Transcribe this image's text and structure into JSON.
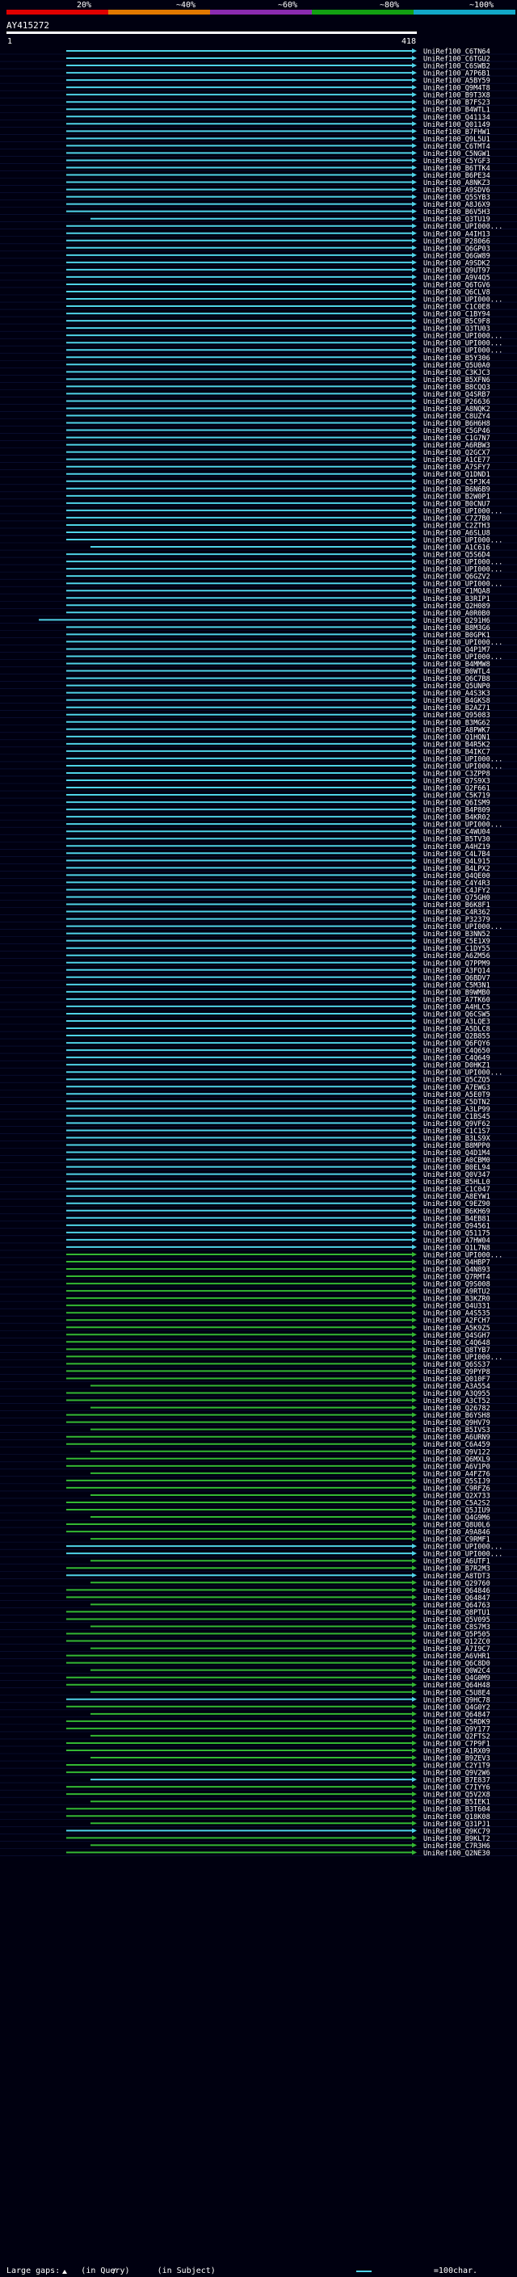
{
  "scale": {
    "labels": [
      "20%",
      "~40%",
      "~60%",
      "~80%",
      "~100%"
    ],
    "colors": [
      "#e00000",
      "#e07800",
      "#8a2bb0",
      "#12a012",
      "#12a8c8"
    ]
  },
  "query": {
    "id": "AY415272",
    "start": "1",
    "end": "418"
  },
  "colors": {
    "background": "#000010",
    "cyan": "#4fd3e8",
    "green": "#33b833",
    "query_bar": "#ffffff"
  },
  "hits": [
    {
      "id": "UniRef100_C6TN64",
      "c": "c"
    },
    {
      "id": "UniRef100_C6TGU2",
      "c": "c"
    },
    {
      "id": "UniRef100_C6SWB2",
      "c": "c"
    },
    {
      "id": "UniRef100_A7P6B1",
      "c": "c"
    },
    {
      "id": "UniRef100_A5BY59",
      "c": "c"
    },
    {
      "id": "UniRef100_Q9M4T8",
      "c": "c"
    },
    {
      "id": "UniRef100_B9T3X8",
      "c": "c"
    },
    {
      "id": "UniRef100_B7FS23",
      "c": "c"
    },
    {
      "id": "UniRef100_B4WTL1",
      "c": "c"
    },
    {
      "id": "UniRef100_Q41134",
      "c": "c"
    },
    {
      "id": "UniRef100_Q01149",
      "c": "c"
    },
    {
      "id": "UniRef100_B7FHW1",
      "c": "c"
    },
    {
      "id": "UniRef100_Q9L5U1",
      "c": "c"
    },
    {
      "id": "UniRef100_C6TMT4",
      "c": "c"
    },
    {
      "id": "UniRef100_C5NGW1",
      "c": "c"
    },
    {
      "id": "UniRef100_C5YGF3",
      "c": "c"
    },
    {
      "id": "UniRef100_B6TTK4",
      "c": "c"
    },
    {
      "id": "UniRef100_B6PE34",
      "c": "c"
    },
    {
      "id": "UniRef100_A8NKZ3",
      "c": "c"
    },
    {
      "id": "UniRef100_A9SDV6",
      "c": "c"
    },
    {
      "id": "UniRef100_Q5SYB3",
      "c": "c"
    },
    {
      "id": "UniRef100_A8J6X9",
      "c": "c"
    },
    {
      "id": "UniRef100_B6V5H3",
      "c": "c"
    },
    {
      "id": "UniRef100_Q3TU19",
      "c": "c"
    },
    {
      "id": "UniRef100_UPI000...",
      "c": "c"
    },
    {
      "id": "UniRef100_A4IH13",
      "c": "c"
    },
    {
      "id": "UniRef100_P28066",
      "c": "c"
    },
    {
      "id": "UniRef100_Q6GP03",
      "c": "c"
    },
    {
      "id": "UniRef100_Q6GW89",
      "c": "c"
    },
    {
      "id": "UniRef100_A9SDK2",
      "c": "c"
    },
    {
      "id": "UniRef100_Q9UT97",
      "c": "c"
    },
    {
      "id": "UniRef100_A9V4Q5",
      "c": "c"
    },
    {
      "id": "UniRef100_Q6TGV6",
      "c": "c"
    },
    {
      "id": "UniRef100_Q6CLV8",
      "c": "c"
    },
    {
      "id": "UniRef100_UPI000...",
      "c": "c"
    },
    {
      "id": "UniRef100_C1C0E8",
      "c": "c"
    },
    {
      "id": "UniRef100_C1BY94",
      "c": "c"
    },
    {
      "id": "UniRef100_B5C9F8",
      "c": "c"
    },
    {
      "id": "UniRef100_Q3TU03",
      "c": "c"
    },
    {
      "id": "UniRef100_UPI000...",
      "c": "c"
    },
    {
      "id": "UniRef100_UPI000...",
      "c": "c"
    },
    {
      "id": "UniRef100_UPI000...",
      "c": "c"
    },
    {
      "id": "UniRef100_B5Y306",
      "c": "c"
    },
    {
      "id": "UniRef100_Q5U0A0",
      "c": "c"
    },
    {
      "id": "UniRef100_C3KJC3",
      "c": "c"
    },
    {
      "id": "UniRef100_B5XFN6",
      "c": "c"
    },
    {
      "id": "UniRef100_B8CQQ3",
      "c": "c"
    },
    {
      "id": "UniRef100_Q4SRB7",
      "c": "c"
    },
    {
      "id": "UniRef100_P26636",
      "c": "c"
    },
    {
      "id": "UniRef100_A8NQK2",
      "c": "c"
    },
    {
      "id": "UniRef100_C8UZY4",
      "c": "c"
    },
    {
      "id": "UniRef100_B6H6H8",
      "c": "c"
    },
    {
      "id": "UniRef100_C5GP46",
      "c": "c"
    },
    {
      "id": "UniRef100_C1G7N7",
      "c": "c"
    },
    {
      "id": "UniRef100_A6RBW3",
      "c": "c"
    },
    {
      "id": "UniRef100_Q2GCX7",
      "c": "c"
    },
    {
      "id": "UniRef100_A1CE77",
      "c": "c"
    },
    {
      "id": "UniRef100_A7SFY7",
      "c": "c"
    },
    {
      "id": "UniRef100_Q1DND1",
      "c": "c"
    },
    {
      "id": "UniRef100_C5PJK4",
      "c": "c"
    },
    {
      "id": "UniRef100_B6N6B9",
      "c": "c"
    },
    {
      "id": "UniRef100_B2W0P1",
      "c": "c"
    },
    {
      "id": "UniRef100_B0CNU7",
      "c": "c"
    },
    {
      "id": "UniRef100_UPI000...",
      "c": "c"
    },
    {
      "id": "UniRef100_C7Z7B0",
      "c": "c"
    },
    {
      "id": "UniRef100_C2ZTH3",
      "c": "c"
    },
    {
      "id": "UniRef100_A6SLU8",
      "c": "c"
    },
    {
      "id": "UniRef100_UPI000...",
      "c": "c"
    },
    {
      "id": "UniRef100_A1C616",
      "c": "c"
    },
    {
      "id": "UniRef100_Q5S6D4",
      "c": "c"
    },
    {
      "id": "UniRef100_UPI000...",
      "c": "c"
    },
    {
      "id": "UniRef100_UPI000...",
      "c": "c"
    },
    {
      "id": "UniRef100_Q6GZV2",
      "c": "c"
    },
    {
      "id": "UniRef100_UPI000...",
      "c": "c"
    },
    {
      "id": "UniRef100_C1MQA8",
      "c": "c"
    },
    {
      "id": "UniRef100_B3RIP1",
      "c": "c"
    },
    {
      "id": "UniRef100_Q2H089",
      "c": "c"
    },
    {
      "id": "UniRef100_A0R0B0",
      "c": "c"
    },
    {
      "id": "UniRef100_Q291H6",
      "c": "c"
    },
    {
      "id": "UniRef100_B8M3G6",
      "c": "c"
    },
    {
      "id": "UniRef100_B0GPK1",
      "c": "c"
    },
    {
      "id": "UniRef100_UPI000...",
      "c": "c"
    },
    {
      "id": "UniRef100_Q4P1M7",
      "c": "c"
    },
    {
      "id": "UniRef100_UPI000...",
      "c": "c"
    },
    {
      "id": "UniRef100_B4MMW8",
      "c": "c"
    },
    {
      "id": "UniRef100_B0WTL4",
      "c": "c"
    },
    {
      "id": "UniRef100_Q6C7B8",
      "c": "c"
    },
    {
      "id": "UniRef100_Q5UNP0",
      "c": "c"
    },
    {
      "id": "UniRef100_A4S3K3",
      "c": "c"
    },
    {
      "id": "UniRef100_B4GKS8",
      "c": "c"
    },
    {
      "id": "UniRef100_B2AZ71",
      "c": "c"
    },
    {
      "id": "UniRef100_Q95083",
      "c": "c"
    },
    {
      "id": "UniRef100_B3MG62",
      "c": "c"
    },
    {
      "id": "UniRef100_A8PWK7",
      "c": "c"
    },
    {
      "id": "UniRef100_Q1HQN1",
      "c": "c"
    },
    {
      "id": "UniRef100_B4R5K2",
      "c": "c"
    },
    {
      "id": "UniRef100_B4IKC7",
      "c": "c"
    },
    {
      "id": "UniRef100_UPI000...",
      "c": "c"
    },
    {
      "id": "UniRef100_UPI000...",
      "c": "c"
    },
    {
      "id": "UniRef100_C3ZPP8",
      "c": "c"
    },
    {
      "id": "UniRef100_Q7S9X3",
      "c": "c"
    },
    {
      "id": "UniRef100_Q2F661",
      "c": "c"
    },
    {
      "id": "UniRef100_C5K719",
      "c": "c"
    },
    {
      "id": "UniRef100_Q6ISM9",
      "c": "c"
    },
    {
      "id": "UniRef100_B4P809",
      "c": "c"
    },
    {
      "id": "UniRef100_B4KR02",
      "c": "c"
    },
    {
      "id": "UniRef100_UPI000...",
      "c": "c"
    },
    {
      "id": "UniRef100_C4WU04",
      "c": "c"
    },
    {
      "id": "UniRef100_B5TV30",
      "c": "c"
    },
    {
      "id": "UniRef100_A4HZ19",
      "c": "c"
    },
    {
      "id": "UniRef100_C4L7B4",
      "c": "c"
    },
    {
      "id": "UniRef100_Q4L915",
      "c": "c"
    },
    {
      "id": "UniRef100_B4LPX2",
      "c": "c"
    },
    {
      "id": "UniRef100_Q4QE00",
      "c": "c"
    },
    {
      "id": "UniRef100_C4Y4R3",
      "c": "c"
    },
    {
      "id": "UniRef100_C4JFY2",
      "c": "c"
    },
    {
      "id": "UniRef100_Q75GH0",
      "c": "c"
    },
    {
      "id": "UniRef100_B6K8F1",
      "c": "c"
    },
    {
      "id": "UniRef100_C4R362",
      "c": "c"
    },
    {
      "id": "UniRef100_P32379",
      "c": "c"
    },
    {
      "id": "UniRef100_UPI000...",
      "c": "c"
    },
    {
      "id": "UniRef100_B3NN52",
      "c": "c"
    },
    {
      "id": "UniRef100_C5E1X9",
      "c": "c"
    },
    {
      "id": "UniRef100_C1DY55",
      "c": "c"
    },
    {
      "id": "UniRef100_A6ZM56",
      "c": "c"
    },
    {
      "id": "UniRef100_Q7PPM9",
      "c": "c"
    },
    {
      "id": "UniRef100_A3FQ14",
      "c": "c"
    },
    {
      "id": "UniRef100_Q6BDV7",
      "c": "c"
    },
    {
      "id": "UniRef100_C5M3N1",
      "c": "c"
    },
    {
      "id": "UniRef100_B9WMB0",
      "c": "c"
    },
    {
      "id": "UniRef100_A7TK60",
      "c": "c"
    },
    {
      "id": "UniRef100_A4HLC5",
      "c": "c"
    },
    {
      "id": "UniRef100_Q6CSW5",
      "c": "c"
    },
    {
      "id": "UniRef100_A3LQE3",
      "c": "c"
    },
    {
      "id": "UniRef100_A5DLC8",
      "c": "c"
    },
    {
      "id": "UniRef100_Q2B855",
      "c": "c"
    },
    {
      "id": "UniRef100_Q6FQY6",
      "c": "c"
    },
    {
      "id": "UniRef100_C4Q650",
      "c": "c"
    },
    {
      "id": "UniRef100_C4Q649",
      "c": "c"
    },
    {
      "id": "UniRef100_D0HKZ1",
      "c": "c"
    },
    {
      "id": "UniRef100_UPI000...",
      "c": "c"
    },
    {
      "id": "UniRef100_Q5CZQ5",
      "c": "c"
    },
    {
      "id": "UniRef100_A7EWG3",
      "c": "c"
    },
    {
      "id": "UniRef100_A5E0T9",
      "c": "c"
    },
    {
      "id": "UniRef100_C5DTN2",
      "c": "c"
    },
    {
      "id": "UniRef100_A3LP99",
      "c": "c"
    },
    {
      "id": "UniRef100_C1BS45",
      "c": "c"
    },
    {
      "id": "UniRef100_Q9VF62",
      "c": "c"
    },
    {
      "id": "UniRef100_C1C1S7",
      "c": "c"
    },
    {
      "id": "UniRef100_B3LS9X",
      "c": "c"
    },
    {
      "id": "UniRef100_B8MPP0",
      "c": "c"
    },
    {
      "id": "UniRef100_Q4D1M4",
      "c": "c"
    },
    {
      "id": "UniRef100_A0CBM0",
      "c": "c"
    },
    {
      "id": "UniRef100_B0EL94",
      "c": "c"
    },
    {
      "id": "UniRef100_Q0V347",
      "c": "c"
    },
    {
      "id": "UniRef100_B5HLL0",
      "c": "c"
    },
    {
      "id": "UniRef100_C1C047",
      "c": "c"
    },
    {
      "id": "UniRef100_A8EYW1",
      "c": "c"
    },
    {
      "id": "UniRef100_C9EZ90",
      "c": "c"
    },
    {
      "id": "UniRef100_B6KH69",
      "c": "c"
    },
    {
      "id": "UniRef100_B4EB81",
      "c": "c"
    },
    {
      "id": "UniRef100_Q94561",
      "c": "c"
    },
    {
      "id": "UniRef100_Q51175",
      "c": "c"
    },
    {
      "id": "UniRef100_A7HW04",
      "c": "c"
    },
    {
      "id": "UniRef100_Q1L7N8",
      "c": "c"
    },
    {
      "id": "UniRef100_UPI000...",
      "c": "g"
    },
    {
      "id": "UniRef100_Q4HBP7",
      "c": "g"
    },
    {
      "id": "UniRef100_Q4N893",
      "c": "g"
    },
    {
      "id": "UniRef100_Q7RMT4",
      "c": "g"
    },
    {
      "id": "UniRef100_Q9S008",
      "c": "g"
    },
    {
      "id": "UniRef100_A9RTU2",
      "c": "g"
    },
    {
      "id": "UniRef100_B3KZR0",
      "c": "g"
    },
    {
      "id": "UniRef100_Q4U331",
      "c": "g"
    },
    {
      "id": "UniRef100_A4S535",
      "c": "g"
    },
    {
      "id": "UniRef100_A2FCH7",
      "c": "g"
    },
    {
      "id": "UniRef100_A5K9Z5",
      "c": "g"
    },
    {
      "id": "UniRef100_Q4SGH7",
      "c": "g"
    },
    {
      "id": "UniRef100_C4Q648",
      "c": "g"
    },
    {
      "id": "UniRef100_Q8TYB7",
      "c": "g"
    },
    {
      "id": "UniRef100_UPI000...",
      "c": "g"
    },
    {
      "id": "UniRef100_Q6SS37",
      "c": "g"
    },
    {
      "id": "UniRef100_Q9PYP8",
      "c": "g"
    },
    {
      "id": "UniRef100_Q010F7",
      "c": "g"
    },
    {
      "id": "UniRef100_A3A554",
      "c": "g"
    },
    {
      "id": "UniRef100_A3Q955",
      "c": "g"
    },
    {
      "id": "UniRef100_A3CT52",
      "c": "g"
    },
    {
      "id": "UniRef100_Q26782",
      "c": "g"
    },
    {
      "id": "UniRef100_B6YSH8",
      "c": "g"
    },
    {
      "id": "UniRef100_Q9HV79",
      "c": "g"
    },
    {
      "id": "UniRef100_B5IVS3",
      "c": "g"
    },
    {
      "id": "UniRef100_A6URN9",
      "c": "g"
    },
    {
      "id": "UniRef100_C6A459",
      "c": "g"
    },
    {
      "id": "UniRef100_Q9V122",
      "c": "g"
    },
    {
      "id": "UniRef100_Q6MXL9",
      "c": "g"
    },
    {
      "id": "UniRef100_A6V1P0",
      "c": "g"
    },
    {
      "id": "UniRef100_A4FZ76",
      "c": "g"
    },
    {
      "id": "UniRef100_Q5SIJ9",
      "c": "g"
    },
    {
      "id": "UniRef100_C9RFZ6",
      "c": "g"
    },
    {
      "id": "UniRef100_Q2X733",
      "c": "g"
    },
    {
      "id": "UniRef100_C5A2S2",
      "c": "g"
    },
    {
      "id": "UniRef100_Q5JIU9",
      "c": "g"
    },
    {
      "id": "UniRef100_Q4G9M6",
      "c": "g"
    },
    {
      "id": "UniRef100_Q8U0L6",
      "c": "g"
    },
    {
      "id": "UniRef100_A9A846",
      "c": "g"
    },
    {
      "id": "UniRef100_C9RMF1",
      "c": "g"
    },
    {
      "id": "UniRef100_UPI000...",
      "c": "c"
    },
    {
      "id": "UniRef100_UPI000...",
      "c": "c"
    },
    {
      "id": "UniRef100_A6UTF1",
      "c": "g"
    },
    {
      "id": "UniRef100_B7R2M3",
      "c": "g"
    },
    {
      "id": "UniRef100_A8TDT3",
      "c": "c"
    },
    {
      "id": "UniRef100_Q29760",
      "c": "g"
    },
    {
      "id": "UniRef100_Q64846",
      "c": "g"
    },
    {
      "id": "UniRef100_Q64847",
      "c": "g"
    },
    {
      "id": "UniRef100_Q64763",
      "c": "g"
    },
    {
      "id": "UniRef100_Q8PTU1",
      "c": "g"
    },
    {
      "id": "UniRef100_Q5V095",
      "c": "g"
    },
    {
      "id": "UniRef100_C8S7M3",
      "c": "g"
    },
    {
      "id": "UniRef100_Q5P505",
      "c": "g"
    },
    {
      "id": "UniRef100_Q12ZC0",
      "c": "g"
    },
    {
      "id": "UniRef100_A7I9C7",
      "c": "g"
    },
    {
      "id": "UniRef100_A6VHR1",
      "c": "g"
    },
    {
      "id": "UniRef100_Q6C8D0",
      "c": "g"
    },
    {
      "id": "UniRef100_Q0W2C4",
      "c": "g"
    },
    {
      "id": "UniRef100_Q4G0M9",
      "c": "g"
    },
    {
      "id": "UniRef100_Q64H48",
      "c": "g"
    },
    {
      "id": "UniRef100_C5U8E4",
      "c": "g"
    },
    {
      "id": "UniRef100_Q9HC78",
      "c": "c"
    },
    {
      "id": "UniRef100_Q4G0Y2",
      "c": "g"
    },
    {
      "id": "UniRef100_Q64847",
      "c": "g"
    },
    {
      "id": "UniRef100_C5RDK9",
      "c": "g"
    },
    {
      "id": "UniRef100_Q9Y177",
      "c": "g"
    },
    {
      "id": "UniRef100_Q2FTS2",
      "c": "g"
    },
    {
      "id": "UniRef100_C7P9F1",
      "c": "g"
    },
    {
      "id": "UniRef100_A1RX09",
      "c": "g"
    },
    {
      "id": "UniRef100_B9ZEV3",
      "c": "g"
    },
    {
      "id": "UniRef100_C2Y1T9",
      "c": "g"
    },
    {
      "id": "UniRef100_Q9V2W6",
      "c": "g"
    },
    {
      "id": "UniRef100_B7E837",
      "c": "c"
    },
    {
      "id": "UniRef100_C7IYY6",
      "c": "g"
    },
    {
      "id": "UniRef100_Q5V2X8",
      "c": "g"
    },
    {
      "id": "UniRef100_B5IEK1",
      "c": "g"
    },
    {
      "id": "UniRef100_B3T604",
      "c": "g"
    },
    {
      "id": "UniRef100_Q18K08",
      "c": "g"
    },
    {
      "id": "UniRef100_Q31PJ1",
      "c": "g"
    },
    {
      "id": "UniRef100_Q9KC79",
      "c": "c"
    },
    {
      "id": "UniRef100_B9KLT2",
      "c": "g"
    },
    {
      "id": "UniRef100_C7R3H6",
      "c": "g"
    },
    {
      "id": "UniRef100_Q2NE30",
      "c": "g"
    }
  ],
  "legend": {
    "gaps_label": "Large gaps:",
    "query_gap": "(in Query)",
    "subject_gap": "(in Subject)",
    "scale_label": "=100char."
  }
}
